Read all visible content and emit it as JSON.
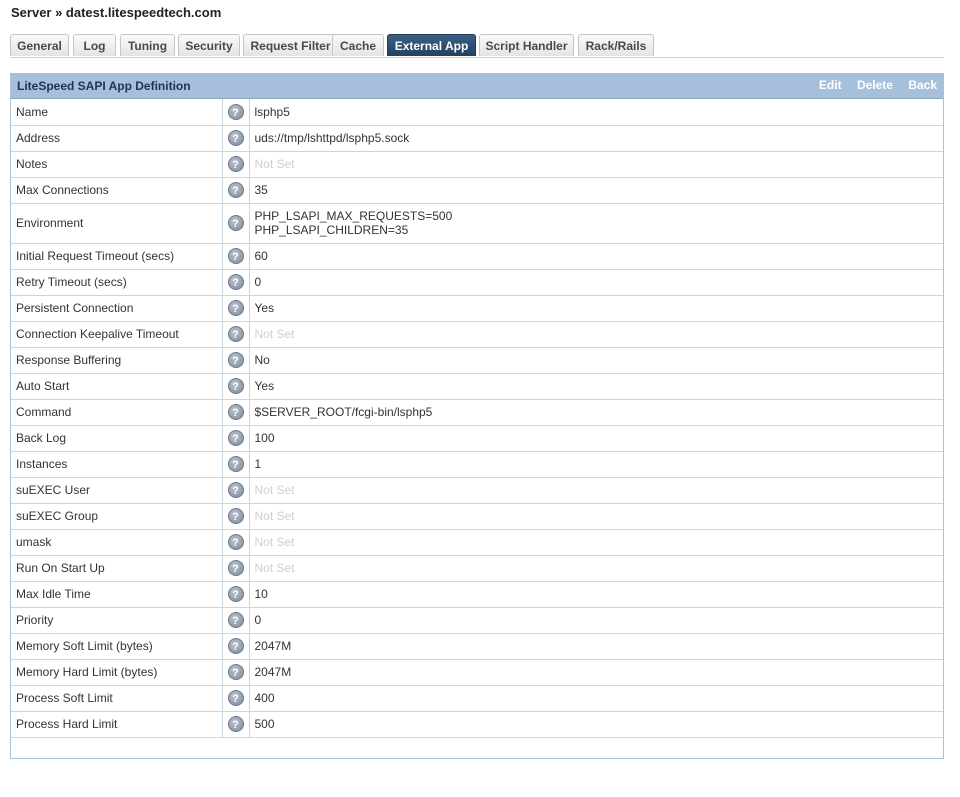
{
  "breadcrumb": "Server » datest.litespeedtech.com",
  "tabs": [
    {
      "label": "General",
      "active": false
    },
    {
      "label": "Log",
      "active": false
    },
    {
      "label": "Tuning",
      "active": false
    },
    {
      "label": "Security",
      "active": false
    },
    {
      "label": "Request Filter",
      "active": false
    },
    {
      "label": "Cache",
      "active": false
    },
    {
      "label": "External App",
      "active": true
    },
    {
      "label": "Script Handler",
      "active": false
    },
    {
      "label": "Rack/Rails",
      "active": false
    }
  ],
  "panel": {
    "title": "LiteSpeed SAPI App Definition",
    "actions": {
      "edit": "Edit",
      "delete": "Delete",
      "back": "Back"
    },
    "help_glyph": "?",
    "rows": [
      {
        "label": "Name",
        "value": "lsphp5",
        "not_set": false
      },
      {
        "label": "Address",
        "value": "uds://tmp/lshttpd/lsphp5.sock",
        "not_set": false
      },
      {
        "label": "Notes",
        "value": "Not Set",
        "not_set": true
      },
      {
        "label": "Max Connections",
        "value": "35",
        "not_set": false
      },
      {
        "label": "Environment",
        "value": "PHP_LSAPI_MAX_REQUESTS=500\nPHP_LSAPI_CHILDREN=35",
        "not_set": false
      },
      {
        "label": "Initial Request Timeout (secs)",
        "value": "60",
        "not_set": false
      },
      {
        "label": "Retry Timeout (secs)",
        "value": "0",
        "not_set": false
      },
      {
        "label": "Persistent Connection",
        "value": "Yes",
        "not_set": false
      },
      {
        "label": "Connection Keepalive Timeout",
        "value": "Not Set",
        "not_set": true
      },
      {
        "label": "Response Buffering",
        "value": "No",
        "not_set": false
      },
      {
        "label": "Auto Start",
        "value": "Yes",
        "not_set": false
      },
      {
        "label": "Command",
        "value": "$SERVER_ROOT/fcgi-bin/lsphp5",
        "not_set": false
      },
      {
        "label": "Back Log",
        "value": "100",
        "not_set": false
      },
      {
        "label": "Instances",
        "value": "1",
        "not_set": false
      },
      {
        "label": "suEXEC User",
        "value": "Not Set",
        "not_set": true
      },
      {
        "label": "suEXEC Group",
        "value": "Not Set",
        "not_set": true
      },
      {
        "label": "umask",
        "value": "Not Set",
        "not_set": true
      },
      {
        "label": "Run On Start Up",
        "value": "Not Set",
        "not_set": true
      },
      {
        "label": "Max Idle Time",
        "value": "10",
        "not_set": false
      },
      {
        "label": "Priority",
        "value": "0",
        "not_set": false
      },
      {
        "label": "Memory Soft Limit (bytes)",
        "value": "2047M",
        "not_set": false
      },
      {
        "label": "Memory Hard Limit (bytes)",
        "value": "2047M",
        "not_set": false
      },
      {
        "label": "Process Soft Limit",
        "value": "400",
        "not_set": false
      },
      {
        "label": "Process Hard Limit",
        "value": "500",
        "not_set": false
      }
    ]
  }
}
